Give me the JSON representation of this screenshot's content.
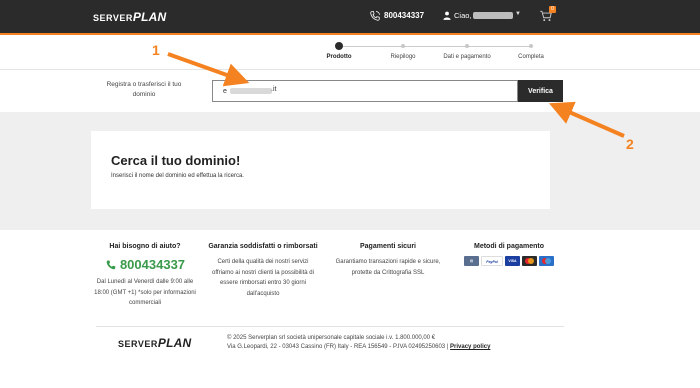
{
  "header": {
    "logo_part1": "SERVER",
    "logo_part2": "PLAN",
    "phone": "800434337",
    "greeting": "Ciao,",
    "cart_count": "0"
  },
  "steps": [
    {
      "label": "Prodotto",
      "active": true
    },
    {
      "label": "Riepilogo",
      "active": false
    },
    {
      "label": "Dati e pagamento",
      "active": false
    },
    {
      "label": "Completa",
      "active": false
    }
  ],
  "search": {
    "label": "Registra o trasferisci il tuo dominio",
    "value_prefix": "e",
    "value_suffix": ".it",
    "button": "Verifica"
  },
  "card": {
    "title": "Cerca il tuo dominio!",
    "subtitle": "Inserisci il nome del dominio ed effettua la ricerca."
  },
  "footer": {
    "help": {
      "title": "Hai bisogno di aiuto?",
      "phone": "800434337",
      "text": "Dal Lunedì al Venerdì dalle 9:00 alle 18:00 (GMT +1) *solo per informazioni commerciali"
    },
    "guarantee": {
      "title": "Garanzia soddisfatti o rimborsati",
      "text": "Certi della qualità dei nostri servizi offriamo ai nostri clienti la possibilità di essere rimborsati entro 30 giorni dall'acquisto"
    },
    "secure": {
      "title": "Pagamenti sicuri",
      "text": "Garantiamo transazioni rapide e sicure, protette da Crittografia SSL"
    },
    "methods": {
      "title": "Metodi di pagamento",
      "items": [
        {
          "name": "bonifico",
          "color": "#5a6f8f"
        },
        {
          "name": "PayPal",
          "color": "#ffffff"
        },
        {
          "name": "VISA",
          "color": "#1a3fa0"
        },
        {
          "name": "Mastercard",
          "color": "#2b2b2b"
        },
        {
          "name": "Maestro",
          "color": "#2a6fc8"
        }
      ]
    },
    "legal_line1": "© 2025 Serverplan srl società unipersonale capitale sociale i.v. 1.800.000,00 €",
    "legal_line2": "Via G.Leopardi, 22 - 03043 Cassino (FR) Italy - REA 156549 - P.IVA 02495250603 |",
    "privacy": "Privacy policy"
  },
  "annotations": {
    "one": "1",
    "two": "2",
    "color": "#f58220"
  }
}
